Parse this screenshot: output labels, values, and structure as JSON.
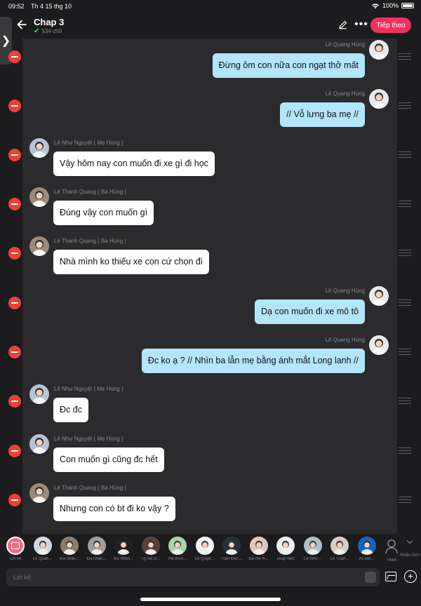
{
  "status": {
    "time": "09:52",
    "date": "Th 4 15 thg 10",
    "battery": "100%"
  },
  "header": {
    "title": "Chap 3",
    "word_count": "534 chữ",
    "next_label": "Tiếp theo"
  },
  "messages": [
    {
      "side": "right",
      "name": "Lê Quang Hùng",
      "text": "Đừng ôm con nữa con ngạt thở mất"
    },
    {
      "side": "right",
      "name": "Lê Quang Hùng",
      "text": "// Vỗ lưng ba mẹ //"
    },
    {
      "side": "left",
      "name": "Lê Như Nguyệt ( Mẹ Hùng )",
      "text": "Vậy hôm nay con muốn đi xe gì đi học"
    },
    {
      "side": "left",
      "name": "Lê Thanh Quang  ( Ba Hùng )",
      "text": "Đúng vậy con muốn gì"
    },
    {
      "side": "left",
      "name": "Lê Thanh Quang  ( Ba Hùng )",
      "text": "Nhà mình ko thiếu xe con cứ chọn đi"
    },
    {
      "side": "right",
      "name": "Lê Quang Hùng",
      "text": "Dạ con muốn đi xe mô tô"
    },
    {
      "side": "right",
      "name": "Lê Quang Hùng",
      "text": "Đc ko ạ ? // Nhìn ba lẫn mẹ bằng ánh mắt Long lanh //"
    },
    {
      "side": "left",
      "name": "Lê Như Nguyệt ( Mẹ Hùng )",
      "text": "Đc đc"
    },
    {
      "side": "left",
      "name": "Lê Như Nguyệt ( Mẹ Hùng )",
      "text": "Con muốn gì cũng đc hết"
    },
    {
      "side": "left",
      "name": "Lê Thanh Quang  ( Ba Hùng )",
      "text": "Nhưng con có bt đi ko vậy ?"
    }
  ],
  "characters": [
    {
      "label": "Lời kể",
      "color": "#f06b8a"
    },
    {
      "label": "Lê Quan...",
      "color": "#cfd8dc"
    },
    {
      "label": "Đa nhân...",
      "color": "#8d7b68"
    },
    {
      "label": "Đa nhân...",
      "color": "#9e9e9e"
    },
    {
      "label": "Đa nhân...",
      "color": "#212121"
    },
    {
      "label": "Tg mê D...",
      "color": "#5d4037"
    },
    {
      "label": "Hệ thốn...",
      "color": "#a5d6a7"
    },
    {
      "label": "Lê Quyề...",
      "color": "#f5f5f5"
    },
    {
      "label": "Trần Đăn...",
      "color": "#263238"
    },
    {
      "label": "Ba mẹ H...",
      "color": "#e0c8c0"
    },
    {
      "label": "Giúp việc",
      "color": "#eceff1"
    },
    {
      "label": "Lê Như...",
      "color": "#b0bec5"
    },
    {
      "label": "Lê Than...",
      "color": "#d7ccc8"
    },
    {
      "label": "All Bel...",
      "color": "#1565c0"
    }
  ],
  "strip": {
    "add_label": "Thêm",
    "more_label": "Nhiều hơn"
  },
  "input": {
    "placeholder": "Lời kể"
  },
  "colors": {
    "accent": "#f0315f",
    "right_bubble": "#b3e5fc",
    "left_bubble": "#ffffff",
    "delete": "#ee4035"
  }
}
